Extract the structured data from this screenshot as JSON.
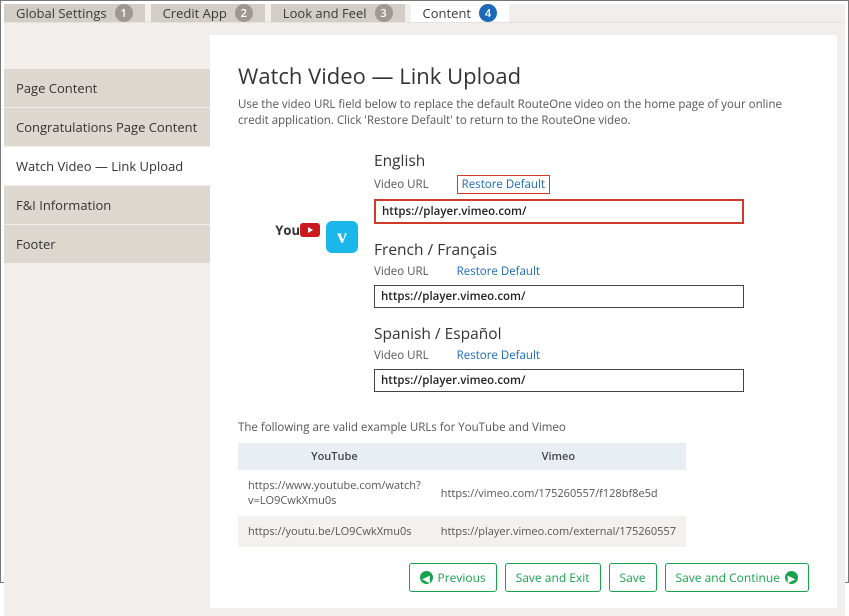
{
  "tabs": [
    {
      "label": "Global Settings",
      "num": "1"
    },
    {
      "label": "Credit App",
      "num": "2"
    },
    {
      "label": "Look and Feel",
      "num": "3"
    },
    {
      "label": "Content",
      "num": "4"
    }
  ],
  "sidebar": [
    {
      "label": "Page Content"
    },
    {
      "label": "Congratulations Page Content"
    },
    {
      "label": "Watch Video — Link Upload"
    },
    {
      "label": "F&I Information"
    },
    {
      "label": "Footer"
    }
  ],
  "page": {
    "title": "Watch Video — Link Upload",
    "description": "Use the video URL field below to replace the default RouteOne video on the home page of your online credit application. Click 'Restore Default' to return to the RouteOne video."
  },
  "languages": [
    {
      "title": "English",
      "url_label": "Video URL",
      "restore": "Restore Default",
      "value": "https://player.vimeo.com/"
    },
    {
      "title": "French / Français",
      "url_label": "Video URL",
      "restore": "Restore Default",
      "value": "https://player.vimeo.com/"
    },
    {
      "title": "Spanish / Español",
      "url_label": "Video URL",
      "restore": "Restore Default",
      "value": "https://player.vimeo.com/"
    }
  ],
  "examples": {
    "note": "The following are valid example URLs for YouTube and Vimeo",
    "headers": [
      "YouTube",
      "Vimeo"
    ],
    "rows": [
      [
        "https://www.youtube.com/watch?v=LO9CwkXmu0s",
        "https://vimeo.com/175260557/f128bf8e5d"
      ],
      [
        "https://youtu.be/LO9CwkXmu0s",
        "https://player.vimeo.com/external/175260557"
      ]
    ]
  },
  "buttons": {
    "previous": "Previous",
    "save_exit": "Save and Exit",
    "save": "Save",
    "save_continue": "Save and Continue"
  }
}
